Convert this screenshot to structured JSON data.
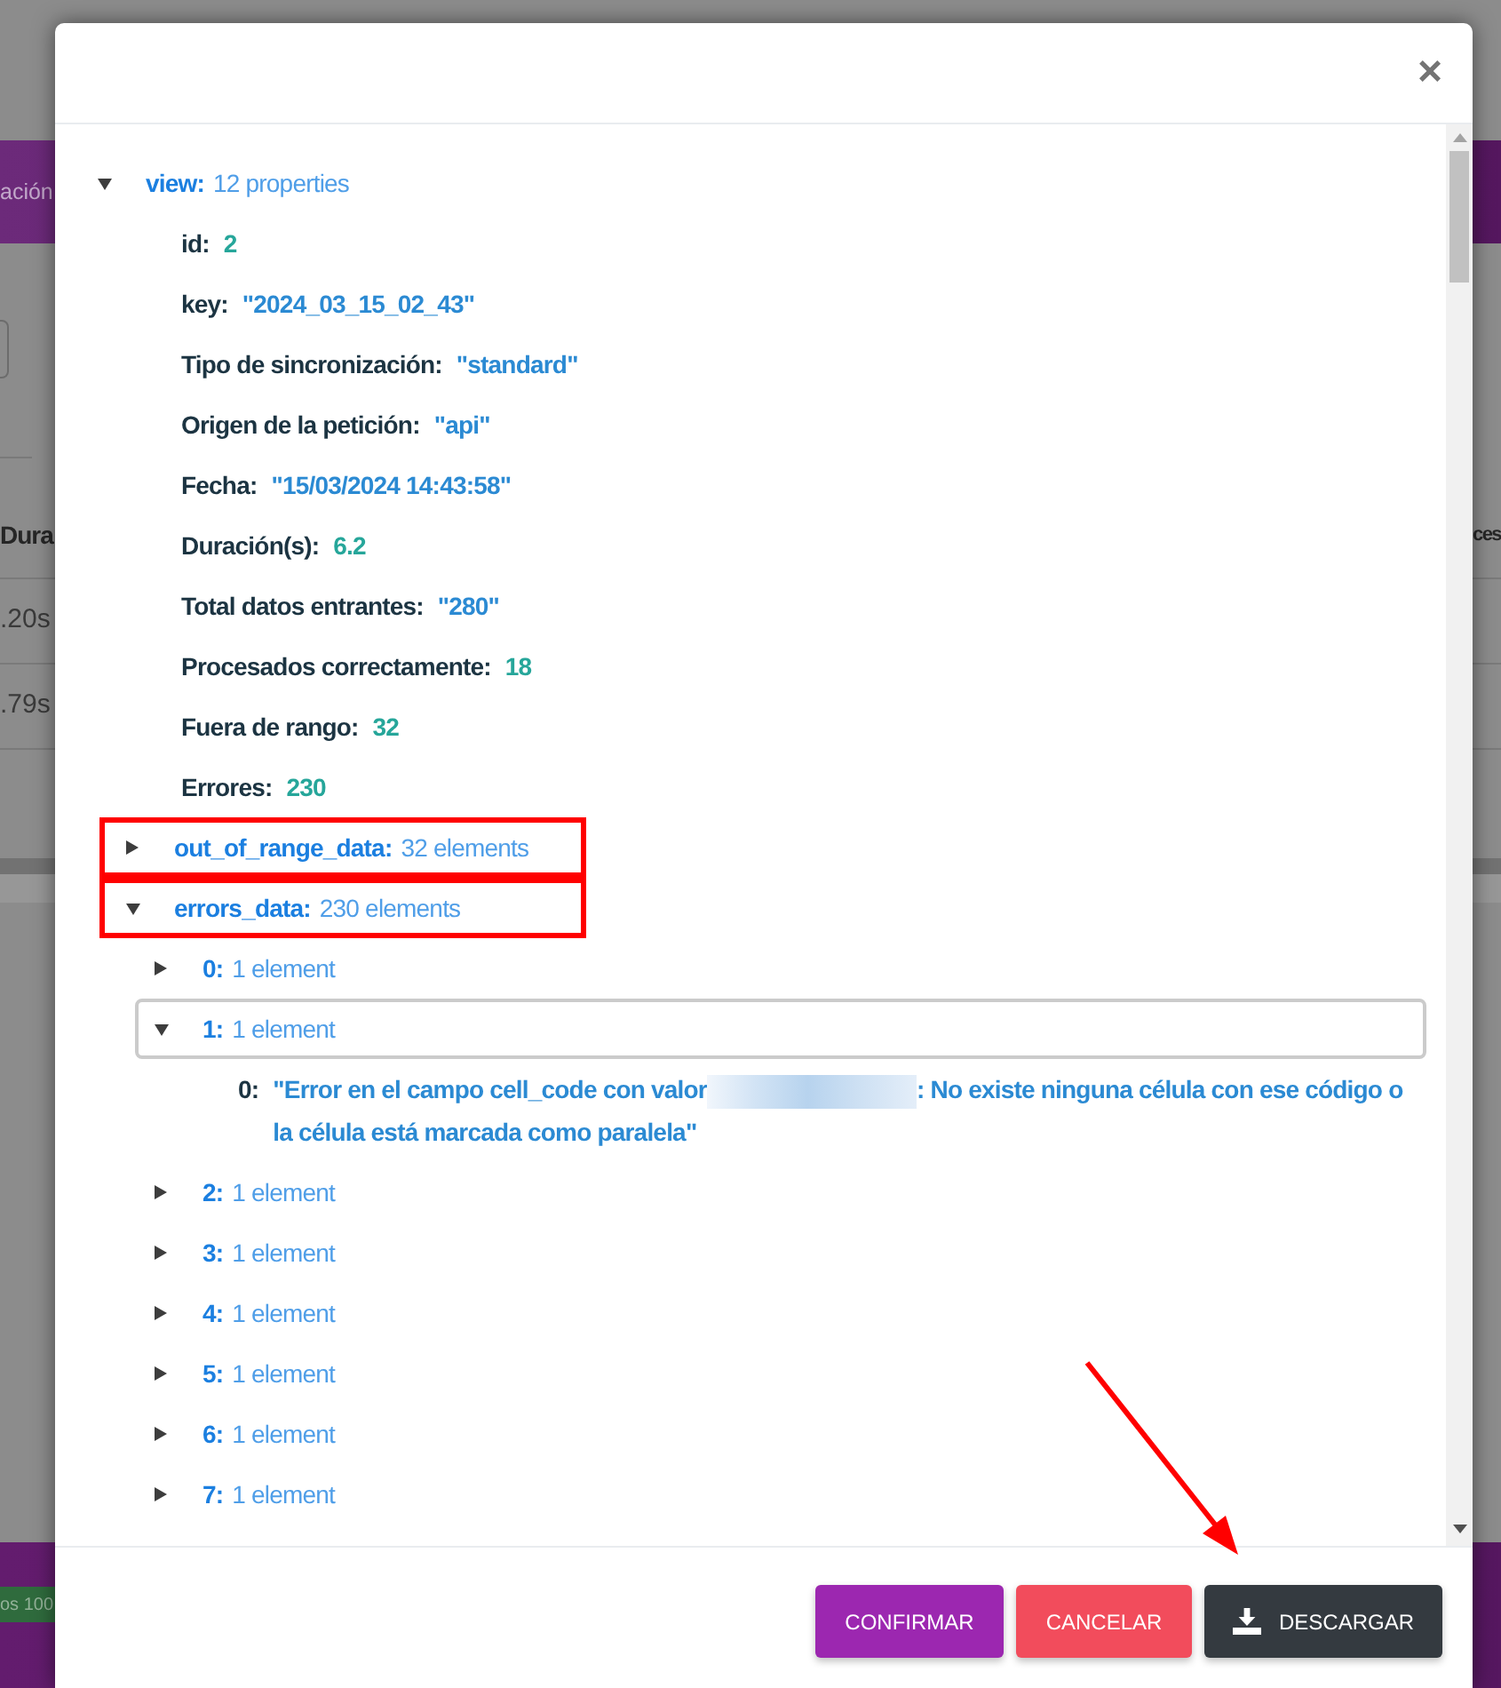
{
  "background_page": {
    "header_title": "ación",
    "table": {
      "columns": [
        "Dura",
        "ces"
      ],
      "rows": [
        ".20s",
        ".79s"
      ]
    },
    "footer_badge": "os 100"
  },
  "dialog": {
    "close_label": "×",
    "annotation_arrow": true,
    "tree": [
      {
        "kind": "node",
        "label": "view:",
        "summary": "12 properties",
        "expanded": true,
        "selected": false,
        "children": [
          {
            "kind": "number",
            "label": "id:",
            "value": "2",
            "highlighted": false
          },
          {
            "kind": "string",
            "label": "key:",
            "value": "\"2024_03_15_02_43\"",
            "highlighted": false
          },
          {
            "kind": "string",
            "label": "Tipo de sincronización:",
            "value": "\"standard\"",
            "highlighted": false
          },
          {
            "kind": "string",
            "label": "Origen de la petición:",
            "value": "\"api\"",
            "highlighted": false
          },
          {
            "kind": "string",
            "label": "Fecha:",
            "value": "\"15/03/2024 14:43:58\"",
            "highlighted": false
          },
          {
            "kind": "number",
            "label": "Duración(s):",
            "value": "6.2",
            "highlighted": false
          },
          {
            "kind": "string",
            "label": "Total datos entrantes:",
            "value": "\"280\"",
            "highlighted": false
          },
          {
            "kind": "number",
            "label": "Procesados correctamente:",
            "value": "18",
            "highlighted": false
          },
          {
            "kind": "number",
            "label": "Fuera de rango:",
            "value": "32",
            "highlighted": false
          },
          {
            "kind": "number",
            "label": "Errores:",
            "value": "230",
            "highlighted": false
          },
          {
            "kind": "node",
            "label": "out_of_range_data:",
            "summary": "32 elements",
            "expanded": false,
            "selected": false,
            "highlighted": true
          },
          {
            "kind": "node",
            "label": "errors_data:",
            "summary": "230 elements",
            "expanded": true,
            "selected": false,
            "highlighted": true,
            "children": [
              {
                "kind": "node",
                "label": "0:",
                "summary": "1 element",
                "expanded": false,
                "selected": false
              },
              {
                "kind": "node",
                "label": "1:",
                "summary": "1 element",
                "expanded": true,
                "selected": true,
                "children": [
                  {
                    "kind": "string",
                    "label": "0:",
                    "segments": [
                      {
                        "kind": "text",
                        "text": "\"Error en el campo cell_code con valor"
                      },
                      {
                        "kind": "redacted"
                      },
                      {
                        "kind": "text",
                        "text": ": No existe ninguna célula con ese código o la célula está marcada como paralela\""
                      }
                    ]
                  }
                ]
              },
              {
                "kind": "node",
                "label": "2:",
                "summary": "1 element",
                "expanded": false,
                "selected": false
              },
              {
                "kind": "node",
                "label": "3:",
                "summary": "1 element",
                "expanded": false,
                "selected": false
              },
              {
                "kind": "node",
                "label": "4:",
                "summary": "1 element",
                "expanded": false,
                "selected": false
              },
              {
                "kind": "node",
                "label": "5:",
                "summary": "1 element",
                "expanded": false,
                "selected": false
              },
              {
                "kind": "node",
                "label": "6:",
                "summary": "1 element",
                "expanded": false,
                "selected": false
              },
              {
                "kind": "node",
                "label": "7:",
                "summary": "1 element",
                "expanded": false,
                "selected": false
              }
            ]
          }
        ]
      }
    ],
    "buttons": [
      {
        "kind": "confirm",
        "label": "CONFIRMAR"
      },
      {
        "kind": "cancel",
        "label": "CANCELAR"
      },
      {
        "kind": "download",
        "label": "DESCARGAR"
      }
    ]
  }
}
